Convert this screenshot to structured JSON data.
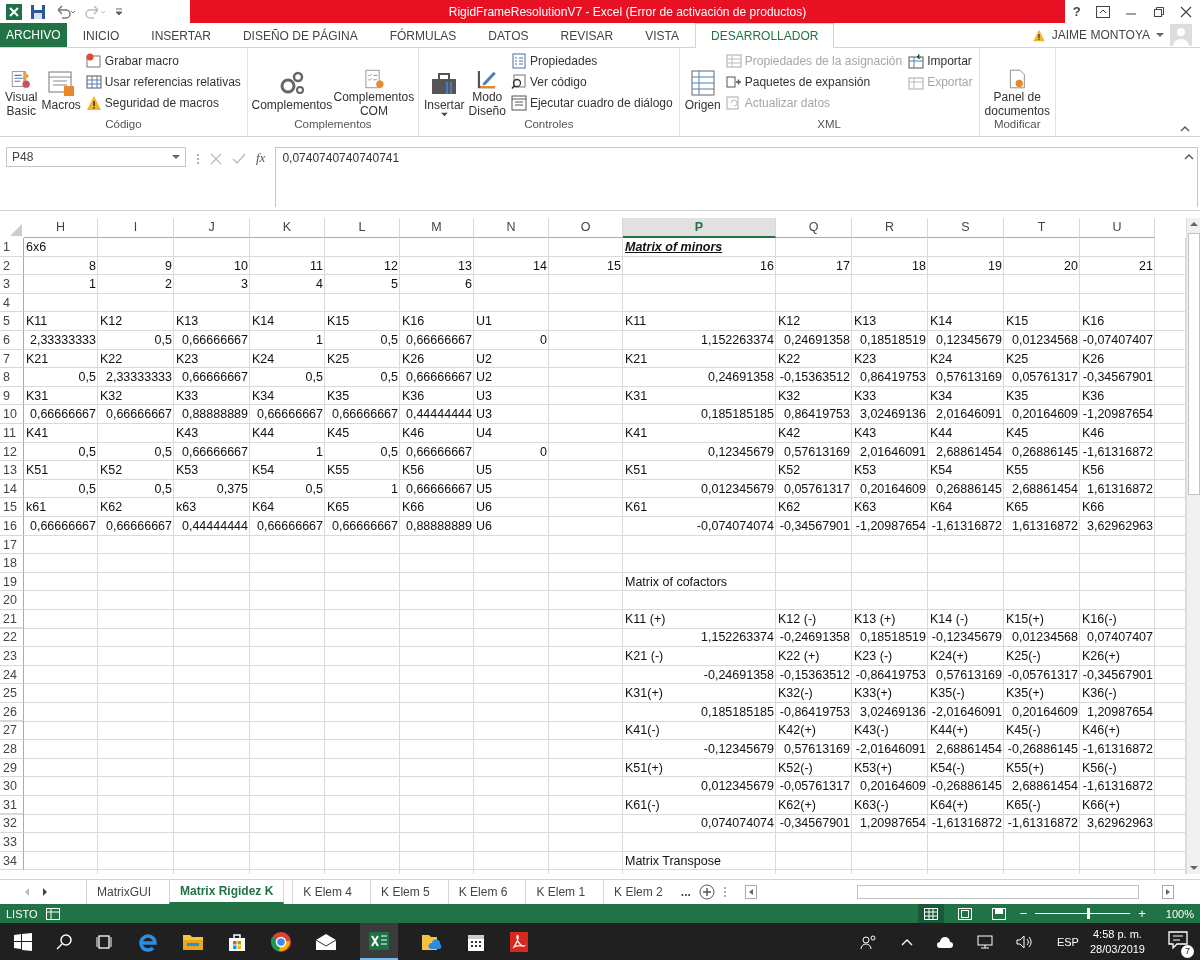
{
  "window": {
    "title": "RigidFrameResolutionV7 -  Excel (Error de activación de productos)",
    "help": "?"
  },
  "ribbon": {
    "file_tab": "ARCHIVO",
    "user": "JAIME MONTOYA",
    "tabs": [
      {
        "label": "INICIO",
        "selected": false
      },
      {
        "label": "INSERTAR",
        "selected": false
      },
      {
        "label": "DISEÑO DE PÁGINA",
        "selected": false
      },
      {
        "label": "FÓRMULAS",
        "selected": false
      },
      {
        "label": "DATOS",
        "selected": false
      },
      {
        "label": "REVISAR",
        "selected": false
      },
      {
        "label": "VISTA",
        "selected": false
      },
      {
        "label": "DESARROLLADOR",
        "selected": true
      }
    ],
    "groups": [
      {
        "label": "Código",
        "large": [
          {
            "label": "Visual\nBasic"
          },
          {
            "label": "Macros"
          }
        ],
        "small_columns": [
          [
            {
              "label": "Grabar macro",
              "disabled": false
            },
            {
              "label": "Usar referencias relativas",
              "disabled": false
            },
            {
              "label": "Seguridad de macros",
              "disabled": false
            }
          ]
        ]
      },
      {
        "label": "Complementos",
        "large": [
          {
            "label": "Complementos"
          },
          {
            "label": "Complementos\nCOM"
          }
        ]
      },
      {
        "label": "Controles",
        "large": [
          {
            "label": "Insertar",
            "dropdown": true
          },
          {
            "label": "Modo\nDiseño"
          }
        ],
        "small_columns": [
          [
            {
              "label": "Propiedades",
              "disabled": false
            },
            {
              "label": "Ver código",
              "disabled": false
            },
            {
              "label": "Ejecutar cuadro de diálogo",
              "disabled": false
            }
          ]
        ]
      },
      {
        "label": "XML",
        "large": [
          {
            "label": "Origen"
          }
        ],
        "small_columns": [
          [
            {
              "label": "Propiedades de la asignación",
              "disabled": true
            },
            {
              "label": "Paquetes de expansión",
              "disabled": false
            },
            {
              "label": "Actualizar datos",
              "disabled": true
            }
          ],
          [
            {
              "label": "Importar",
              "disabled": false
            },
            {
              "label": "Exportar",
              "disabled": true
            }
          ]
        ]
      },
      {
        "label": "Modificar",
        "large": [
          {
            "label": "Panel de\ndocumentos"
          }
        ]
      }
    ]
  },
  "formula_bar": {
    "name_box": "P48",
    "function_label": "fx",
    "value": "0,0740740740740741"
  },
  "grid": {
    "columns": [
      {
        "label": "H",
        "selected": false
      },
      {
        "label": "I",
        "selected": false
      },
      {
        "label": "J",
        "selected": false
      },
      {
        "label": "K",
        "selected": false
      },
      {
        "label": "L",
        "selected": false
      },
      {
        "label": "M",
        "selected": false
      },
      {
        "label": "N",
        "selected": false
      },
      {
        "label": "O",
        "selected": false
      },
      {
        "label": "P",
        "selected": true
      },
      {
        "label": "Q",
        "selected": false
      },
      {
        "label": "R",
        "selected": false
      },
      {
        "label": "S",
        "selected": false
      },
      {
        "label": "T",
        "selected": false
      },
      {
        "label": "U",
        "selected": false
      }
    ],
    "rows": [
      {
        "n": "1",
        "cells": [
          {
            "text": "6x6",
            "kind": "text"
          },
          null,
          null,
          null,
          null,
          null,
          null,
          null,
          {
            "text": "Matrix of minors",
            "kind": "heading"
          }
        ]
      },
      {
        "n": "2",
        "cells": [
          {
            "text": "8",
            "kind": "number"
          },
          {
            "text": "9",
            "kind": "number"
          },
          {
            "text": "10",
            "kind": "number"
          },
          {
            "text": "11",
            "kind": "number"
          },
          {
            "text": "12",
            "kind": "number"
          },
          {
            "text": "13",
            "kind": "number"
          },
          {
            "text": "14",
            "kind": "number"
          },
          {
            "text": "15",
            "kind": "number"
          },
          {
            "text": "16",
            "kind": "number"
          },
          {
            "text": "17",
            "kind": "number"
          },
          {
            "text": "18",
            "kind": "number"
          },
          {
            "text": "19",
            "kind": "number"
          },
          {
            "text": "20",
            "kind": "number"
          },
          {
            "text": "21",
            "kind": "number"
          }
        ]
      },
      {
        "n": "3",
        "cells": [
          {
            "text": "1",
            "kind": "number"
          },
          {
            "text": "2",
            "kind": "number"
          },
          {
            "text": "3",
            "kind": "number"
          },
          {
            "text": "4",
            "kind": "number"
          },
          {
            "text": "5",
            "kind": "number"
          },
          {
            "text": "6",
            "kind": "number"
          }
        ]
      },
      {
        "n": "4"
      },
      {
        "n": "5",
        "cells": [
          {
            "text": "K11",
            "kind": "text"
          },
          {
            "text": "K12",
            "kind": "text"
          },
          {
            "text": "K13",
            "kind": "text"
          },
          {
            "text": "K14",
            "kind": "text"
          },
          {
            "text": "K15",
            "kind": "text"
          },
          {
            "text": "K16",
            "kind": "text"
          },
          {
            "text": "U1",
            "kind": "text"
          },
          null,
          {
            "text": "K11",
            "kind": "text"
          },
          {
            "text": "K12",
            "kind": "text"
          },
          {
            "text": "K13",
            "kind": "text"
          },
          {
            "text": "K14",
            "kind": "text"
          },
          {
            "text": "K15",
            "kind": "text"
          },
          {
            "text": "K16",
            "kind": "text"
          }
        ]
      },
      {
        "n": "6",
        "cells": [
          {
            "text": "2,33333333",
            "kind": "number"
          },
          {
            "text": "0,5",
            "kind": "number"
          },
          {
            "text": "0,66666667",
            "kind": "number"
          },
          {
            "text": "1",
            "kind": "number"
          },
          {
            "text": "0,5",
            "kind": "number"
          },
          {
            "text": "0,66666667",
            "kind": "number"
          },
          {
            "text": "0",
            "kind": "number"
          },
          null,
          {
            "text": "1,152263374",
            "kind": "number"
          },
          {
            "text": "0,24691358",
            "kind": "number"
          },
          {
            "text": "0,18518519",
            "kind": "number"
          },
          {
            "text": "0,12345679",
            "kind": "number"
          },
          {
            "text": "0,01234568",
            "kind": "number"
          },
          {
            "text": "-0,07407407",
            "kind": "number"
          }
        ]
      },
      {
        "n": "7",
        "cells": [
          {
            "text": "K21",
            "kind": "text"
          },
          {
            "text": "K22",
            "kind": "text"
          },
          {
            "text": "K23",
            "kind": "text"
          },
          {
            "text": "K24",
            "kind": "text"
          },
          {
            "text": "K25",
            "kind": "text"
          },
          {
            "text": "K26",
            "kind": "text"
          },
          {
            "text": "U2",
            "kind": "text"
          },
          null,
          {
            "text": "K21",
            "kind": "text"
          },
          {
            "text": "K22",
            "kind": "text"
          },
          {
            "text": "K23",
            "kind": "text"
          },
          {
            "text": "K24",
            "kind": "text"
          },
          {
            "text": "K25",
            "kind": "text"
          },
          {
            "text": "K26",
            "kind": "text"
          }
        ]
      },
      {
        "n": "8",
        "cells": [
          {
            "text": "0,5",
            "kind": "number"
          },
          {
            "text": "2,33333333",
            "kind": "number"
          },
          {
            "text": "0,66666667",
            "kind": "number"
          },
          {
            "text": "0,5",
            "kind": "number"
          },
          {
            "text": "0,5",
            "kind": "number"
          },
          {
            "text": "0,66666667",
            "kind": "number"
          },
          {
            "text": "U2",
            "kind": "text"
          },
          null,
          {
            "text": "0,24691358",
            "kind": "number"
          },
          {
            "text": "-0,15363512",
            "kind": "number"
          },
          {
            "text": "0,86419753",
            "kind": "number"
          },
          {
            "text": "0,57613169",
            "kind": "number"
          },
          {
            "text": "0,05761317",
            "kind": "number"
          },
          {
            "text": "-0,34567901",
            "kind": "number"
          }
        ]
      },
      {
        "n": "9",
        "cells": [
          {
            "text": "K31",
            "kind": "text"
          },
          {
            "text": "K32",
            "kind": "text"
          },
          {
            "text": "K33",
            "kind": "text"
          },
          {
            "text": "K34",
            "kind": "text"
          },
          {
            "text": "K35",
            "kind": "text"
          },
          {
            "text": "K36",
            "kind": "text"
          },
          {
            "text": "U3",
            "kind": "text"
          },
          null,
          {
            "text": "K31",
            "kind": "text"
          },
          {
            "text": "K32",
            "kind": "text"
          },
          {
            "text": "K33",
            "kind": "text"
          },
          {
            "text": "K34",
            "kind": "text"
          },
          {
            "text": "K35",
            "kind": "text"
          },
          {
            "text": "K36",
            "kind": "text"
          }
        ]
      },
      {
        "n": "10",
        "cells": [
          {
            "text": "0,66666667",
            "kind": "number"
          },
          {
            "text": "0,66666667",
            "kind": "number"
          },
          {
            "text": "0,88888889",
            "kind": "number"
          },
          {
            "text": "0,66666667",
            "kind": "number"
          },
          {
            "text": "0,66666667",
            "kind": "number"
          },
          {
            "text": "0,44444444",
            "kind": "number"
          },
          {
            "text": "U3",
            "kind": "text"
          },
          null,
          {
            "text": "0,185185185",
            "kind": "number"
          },
          {
            "text": "0,86419753",
            "kind": "number"
          },
          {
            "text": "3,02469136",
            "kind": "number"
          },
          {
            "text": "2,01646091",
            "kind": "number"
          },
          {
            "text": "0,20164609",
            "kind": "number"
          },
          {
            "text": "-1,20987654",
            "kind": "number"
          }
        ]
      },
      {
        "n": "11",
        "cells": [
          {
            "text": "K41",
            "kind": "text"
          },
          null,
          {
            "text": "K43",
            "kind": "text"
          },
          {
            "text": "K44",
            "kind": "text"
          },
          {
            "text": "K45",
            "kind": "text"
          },
          {
            "text": "K46",
            "kind": "text"
          },
          {
            "text": "U4",
            "kind": "text"
          },
          null,
          {
            "text": "K41",
            "kind": "text"
          },
          {
            "text": "K42",
            "kind": "text"
          },
          {
            "text": "K43",
            "kind": "text"
          },
          {
            "text": "K44",
            "kind": "text"
          },
          {
            "text": "K45",
            "kind": "text"
          },
          {
            "text": "K46",
            "kind": "text"
          }
        ]
      },
      {
        "n": "12",
        "cells": [
          {
            "text": "0,5",
            "kind": "number"
          },
          {
            "text": "0,5",
            "kind": "number"
          },
          {
            "text": "0,66666667",
            "kind": "number"
          },
          {
            "text": "1",
            "kind": "number"
          },
          {
            "text": "0,5",
            "kind": "number"
          },
          {
            "text": "0,66666667",
            "kind": "number"
          },
          {
            "text": "0",
            "kind": "number"
          },
          null,
          {
            "text": "0,12345679",
            "kind": "number"
          },
          {
            "text": "0,57613169",
            "kind": "number"
          },
          {
            "text": "2,01646091",
            "kind": "number"
          },
          {
            "text": "2,68861454",
            "kind": "number"
          },
          {
            "text": "0,26886145",
            "kind": "number"
          },
          {
            "text": "-1,61316872",
            "kind": "number"
          }
        ]
      },
      {
        "n": "13",
        "cells": [
          {
            "text": "K51",
            "kind": "text"
          },
          {
            "text": "K52",
            "kind": "text"
          },
          {
            "text": "K53",
            "kind": "text"
          },
          {
            "text": "K54",
            "kind": "text"
          },
          {
            "text": "K55",
            "kind": "text"
          },
          {
            "text": "K56",
            "kind": "text"
          },
          {
            "text": "U5",
            "kind": "text"
          },
          null,
          {
            "text": "K51",
            "kind": "text"
          },
          {
            "text": "K52",
            "kind": "text"
          },
          {
            "text": "K53",
            "kind": "text"
          },
          {
            "text": "K54",
            "kind": "text"
          },
          {
            "text": "K55",
            "kind": "text"
          },
          {
            "text": "K56",
            "kind": "text"
          }
        ]
      },
      {
        "n": "14",
        "cells": [
          {
            "text": "0,5",
            "kind": "number"
          },
          {
            "text": "0,5",
            "kind": "number"
          },
          {
            "text": "0,375",
            "kind": "number"
          },
          {
            "text": "0,5",
            "kind": "number"
          },
          {
            "text": "1",
            "kind": "number"
          },
          {
            "text": "0,66666667",
            "kind": "number"
          },
          {
            "text": "U5",
            "kind": "text"
          },
          null,
          {
            "text": "0,012345679",
            "kind": "number"
          },
          {
            "text": "0,05761317",
            "kind": "number"
          },
          {
            "text": "0,20164609",
            "kind": "number"
          },
          {
            "text": "0,26886145",
            "kind": "number"
          },
          {
            "text": "2,68861454",
            "kind": "number"
          },
          {
            "text": "1,61316872",
            "kind": "number"
          }
        ]
      },
      {
        "n": "15",
        "cells": [
          {
            "text": "k61",
            "kind": "text"
          },
          {
            "text": "K62",
            "kind": "text"
          },
          {
            "text": "k63",
            "kind": "text"
          },
          {
            "text": "K64",
            "kind": "text"
          },
          {
            "text": "K65",
            "kind": "text"
          },
          {
            "text": "K66",
            "kind": "text"
          },
          {
            "text": "U6",
            "kind": "text"
          },
          null,
          {
            "text": "K61",
            "kind": "text"
          },
          {
            "text": "K62",
            "kind": "text"
          },
          {
            "text": "K63",
            "kind": "text"
          },
          {
            "text": "K64",
            "kind": "text"
          },
          {
            "text": "K65",
            "kind": "text"
          },
          {
            "text": "K66",
            "kind": "text"
          }
        ]
      },
      {
        "n": "16",
        "cells": [
          {
            "text": "0,66666667",
            "kind": "number"
          },
          {
            "text": "0,66666667",
            "kind": "number"
          },
          {
            "text": "0,44444444",
            "kind": "number"
          },
          {
            "text": "0,66666667",
            "kind": "number"
          },
          {
            "text": "0,66666667",
            "kind": "number"
          },
          {
            "text": "0,88888889",
            "kind": "number"
          },
          {
            "text": "U6",
            "kind": "text"
          },
          null,
          {
            "text": "-0,074074074",
            "kind": "number"
          },
          {
            "text": "-0,34567901",
            "kind": "number"
          },
          {
            "text": "-1,20987654",
            "kind": "number"
          },
          {
            "text": "-1,61316872",
            "kind": "number"
          },
          {
            "text": "1,61316872",
            "kind": "number"
          },
          {
            "text": "3,62962963",
            "kind": "number"
          }
        ]
      },
      {
        "n": "17"
      },
      {
        "n": "18"
      },
      {
        "n": "19",
        "cells": [
          null,
          null,
          null,
          null,
          null,
          null,
          null,
          null,
          {
            "text": "Matrix of cofactors",
            "kind": "text"
          }
        ]
      },
      {
        "n": "20"
      },
      {
        "n": "21",
        "cells": [
          null,
          null,
          null,
          null,
          null,
          null,
          null,
          null,
          {
            "text": "K11 (+)",
            "kind": "text"
          },
          {
            "text": "K12 (-)",
            "kind": "text"
          },
          {
            "text": "K13 (+)",
            "kind": "text"
          },
          {
            "text": "K14 (-)",
            "kind": "text"
          },
          {
            "text": "K15(+)",
            "kind": "text"
          },
          {
            "text": "K16(-)",
            "kind": "text"
          }
        ]
      },
      {
        "n": "22",
        "cells": [
          null,
          null,
          null,
          null,
          null,
          null,
          null,
          null,
          {
            "text": "1,152263374",
            "kind": "number"
          },
          {
            "text": "-0,24691358",
            "kind": "number"
          },
          {
            "text": "0,18518519",
            "kind": "number"
          },
          {
            "text": "-0,12345679",
            "kind": "number"
          },
          {
            "text": "0,01234568",
            "kind": "number"
          },
          {
            "text": "0,07407407",
            "kind": "number"
          }
        ]
      },
      {
        "n": "23",
        "cells": [
          null,
          null,
          null,
          null,
          null,
          null,
          null,
          null,
          {
            "text": "K21 (-)",
            "kind": "text"
          },
          {
            "text": "K22 (+)",
            "kind": "text"
          },
          {
            "text": "K23 (-)",
            "kind": "text"
          },
          {
            "text": "K24(+)",
            "kind": "text"
          },
          {
            "text": "K25(-)",
            "kind": "text"
          },
          {
            "text": "K26(+)",
            "kind": "text"
          }
        ]
      },
      {
        "n": "24",
        "cells": [
          null,
          null,
          null,
          null,
          null,
          null,
          null,
          null,
          {
            "text": "-0,24691358",
            "kind": "number"
          },
          {
            "text": "-0,15363512",
            "kind": "number"
          },
          {
            "text": "-0,86419753",
            "kind": "number"
          },
          {
            "text": "0,57613169",
            "kind": "number"
          },
          {
            "text": "-0,05761317",
            "kind": "number"
          },
          {
            "text": "-0,34567901",
            "kind": "number"
          }
        ]
      },
      {
        "n": "25",
        "cells": [
          null,
          null,
          null,
          null,
          null,
          null,
          null,
          null,
          {
            "text": "K31(+)",
            "kind": "text"
          },
          {
            "text": "K32(-)",
            "kind": "text"
          },
          {
            "text": "K33(+)",
            "kind": "text"
          },
          {
            "text": "K35(-)",
            "kind": "text"
          },
          {
            "text": "K35(+)",
            "kind": "text"
          },
          {
            "text": "K36(-)",
            "kind": "text"
          }
        ]
      },
      {
        "n": "26",
        "cells": [
          null,
          null,
          null,
          null,
          null,
          null,
          null,
          null,
          {
            "text": "0,185185185",
            "kind": "number"
          },
          {
            "text": "-0,86419753",
            "kind": "number"
          },
          {
            "text": "3,02469136",
            "kind": "number"
          },
          {
            "text": "-2,01646091",
            "kind": "number"
          },
          {
            "text": "0,20164609",
            "kind": "number"
          },
          {
            "text": "1,20987654",
            "kind": "number"
          }
        ]
      },
      {
        "n": "27",
        "cells": [
          null,
          null,
          null,
          null,
          null,
          null,
          null,
          null,
          {
            "text": "K41(-)",
            "kind": "text"
          },
          {
            "text": "K42(+)",
            "kind": "text"
          },
          {
            "text": "K43(-)",
            "kind": "text"
          },
          {
            "text": "K44(+)",
            "kind": "text"
          },
          {
            "text": "K45(-)",
            "kind": "text"
          },
          {
            "text": "K46(+)",
            "kind": "text"
          }
        ]
      },
      {
        "n": "28",
        "cells": [
          null,
          null,
          null,
          null,
          null,
          null,
          null,
          null,
          {
            "text": "-0,12345679",
            "kind": "number"
          },
          {
            "text": "0,57613169",
            "kind": "number"
          },
          {
            "text": "-2,01646091",
            "kind": "number"
          },
          {
            "text": "2,68861454",
            "kind": "number"
          },
          {
            "text": "-0,26886145",
            "kind": "number"
          },
          {
            "text": "-1,61316872",
            "kind": "number"
          }
        ]
      },
      {
        "n": "29",
        "cells": [
          null,
          null,
          null,
          null,
          null,
          null,
          null,
          null,
          {
            "text": "K51(+)",
            "kind": "text"
          },
          {
            "text": "K52(-)",
            "kind": "text"
          },
          {
            "text": "K53(+)",
            "kind": "text"
          },
          {
            "text": "K54(-)",
            "kind": "text"
          },
          {
            "text": "K55(+)",
            "kind": "text"
          },
          {
            "text": "K56(-)",
            "kind": "text"
          }
        ]
      },
      {
        "n": "30",
        "cells": [
          null,
          null,
          null,
          null,
          null,
          null,
          null,
          null,
          {
            "text": "0,012345679",
            "kind": "number"
          },
          {
            "text": "-0,05761317",
            "kind": "number"
          },
          {
            "text": "0,20164609",
            "kind": "number"
          },
          {
            "text": "-0,26886145",
            "kind": "number"
          },
          {
            "text": "2,68861454",
            "kind": "number"
          },
          {
            "text": "-1,61316872",
            "kind": "number"
          }
        ]
      },
      {
        "n": "31",
        "cells": [
          null,
          null,
          null,
          null,
          null,
          null,
          null,
          null,
          {
            "text": "K61(-)",
            "kind": "text"
          },
          {
            "text": "K62(+)",
            "kind": "text"
          },
          {
            "text": "K63(-)",
            "kind": "text"
          },
          {
            "text": "K64(+)",
            "kind": "text"
          },
          {
            "text": "K65(-)",
            "kind": "text"
          },
          {
            "text": "K66(+)",
            "kind": "text"
          }
        ]
      },
      {
        "n": "32",
        "cells": [
          null,
          null,
          null,
          null,
          null,
          null,
          null,
          null,
          {
            "text": "0,074074074",
            "kind": "number"
          },
          {
            "text": "-0,34567901",
            "kind": "number"
          },
          {
            "text": "1,20987654",
            "kind": "number"
          },
          {
            "text": "-1,61316872",
            "kind": "number"
          },
          {
            "text": "-1,61316872",
            "kind": "number"
          },
          {
            "text": "3,62962963",
            "kind": "number"
          }
        ]
      },
      {
        "n": "33"
      },
      {
        "n": "34",
        "cells": [
          null,
          null,
          null,
          null,
          null,
          null,
          null,
          null,
          {
            "text": "Matrix Transpose",
            "kind": "text"
          }
        ]
      }
    ]
  },
  "sheet_tabs": [
    {
      "label": "MatrixGUI",
      "selected": false
    },
    {
      "label": "Matrix Rigidez K",
      "selected": true
    },
    {
      "label": "K Elem 4",
      "selected": false
    },
    {
      "label": "K Elem 5",
      "selected": false
    },
    {
      "label": "K Elem 6",
      "selected": false
    },
    {
      "label": "K Elem 1",
      "selected": false
    },
    {
      "label": "K Elem 2",
      "selected": false
    }
  ],
  "more_sheets": "...",
  "status_bar": {
    "status": "LISTO",
    "zoom_out": "−",
    "zoom_in": "+",
    "zoom": "100%",
    "zoom_slider": {
      "level": 0.55
    }
  },
  "taskbar": {
    "language": "ESP",
    "time": "4:58 p. m.",
    "date": "28/03/2019",
    "notifications": "7"
  }
}
